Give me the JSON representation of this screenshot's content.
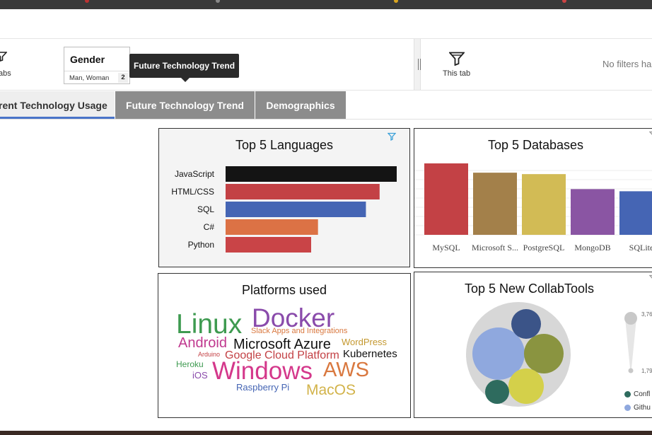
{
  "filterbar": {
    "left_label": "abs",
    "gender": {
      "title": "Gender",
      "value": "Man, Woman",
      "count": "2"
    },
    "tooltip": "Future Technology Trend",
    "this_tab_label": "This tab",
    "no_filters": "No filters ha"
  },
  "tabs": [
    {
      "label": "rent Technology Usage",
      "active": true
    },
    {
      "label": "Future Technology Trend",
      "active": false
    },
    {
      "label": "Demographics",
      "active": false
    }
  ],
  "colors": {
    "accent": "#4a74c9",
    "tab_inactive": "#8c8c8c"
  },
  "cards": {
    "languages": {
      "title": "Top 5 Languages"
    },
    "databases": {
      "title": "Top 5 Databases"
    },
    "platforms": {
      "title": "Platforms used"
    },
    "collab": {
      "title": "Top 5 New CollabTools",
      "scale_max": "3,76",
      "scale_min": "1,79",
      "legend": [
        {
          "label": "Confl",
          "color": "#2e6b5e"
        },
        {
          "label": "Githu",
          "color": "#8fa8de"
        }
      ]
    }
  },
  "chart_data": [
    {
      "type": "bar",
      "orientation": "horizontal",
      "title": "Top 5 Languages",
      "categories": [
        "JavaScript",
        "HTML/CSS",
        "SQL",
        "C#",
        "Python"
      ],
      "values": [
        100,
        90,
        82,
        54,
        50
      ],
      "colors": [
        "#141414",
        "#c34145",
        "#4565b4",
        "#dc7245",
        "#c94447"
      ]
    },
    {
      "type": "bar",
      "title": "Top 5 Databases",
      "categories": [
        "MySQL",
        "Microsoft S...",
        "PostgreSQL",
        "MongoDB",
        "SQLite"
      ],
      "values": [
        100,
        87,
        85,
        64,
        61
      ],
      "colors": [
        "#c34145",
        "#a3804a",
        "#d2bb55",
        "#8a55a3",
        "#4565b4"
      ],
      "grid": true
    },
    {
      "type": "wordcloud",
      "title": "Platforms used",
      "words": [
        {
          "text": "Linux",
          "color": "#3e9a50"
        },
        {
          "text": "Docker",
          "color": "#8a4bab"
        },
        {
          "text": "Slack Apps and Integrations",
          "color": "#d9783f"
        },
        {
          "text": "Android",
          "color": "#c0398f"
        },
        {
          "text": "Microsoft Azure",
          "color": "#111111"
        },
        {
          "text": "WordPress",
          "color": "#c4982f"
        },
        {
          "text": "Arduino",
          "color": "#c34145"
        },
        {
          "text": "Google Cloud Platform",
          "color": "#c34145"
        },
        {
          "text": "Kubernetes",
          "color": "#111111"
        },
        {
          "text": "Heroku",
          "color": "#3e9a50"
        },
        {
          "text": "Windows",
          "color": "#d4388b"
        },
        {
          "text": "AWS",
          "color": "#d9783f"
        },
        {
          "text": "iOS",
          "color": "#8a4bab"
        },
        {
          "text": "Raspberry Pi",
          "color": "#4565b4"
        },
        {
          "text": "MacOS",
          "color": "#d2b34a"
        }
      ]
    },
    {
      "type": "bubble",
      "title": "Top 5 New CollabTools",
      "bubbles": [
        {
          "color": "#8fa8de"
        },
        {
          "color": "#8a9440"
        },
        {
          "color": "#d4d04a"
        },
        {
          "color": "#3b5488"
        },
        {
          "color": "#2e6b5e"
        }
      ]
    }
  ]
}
